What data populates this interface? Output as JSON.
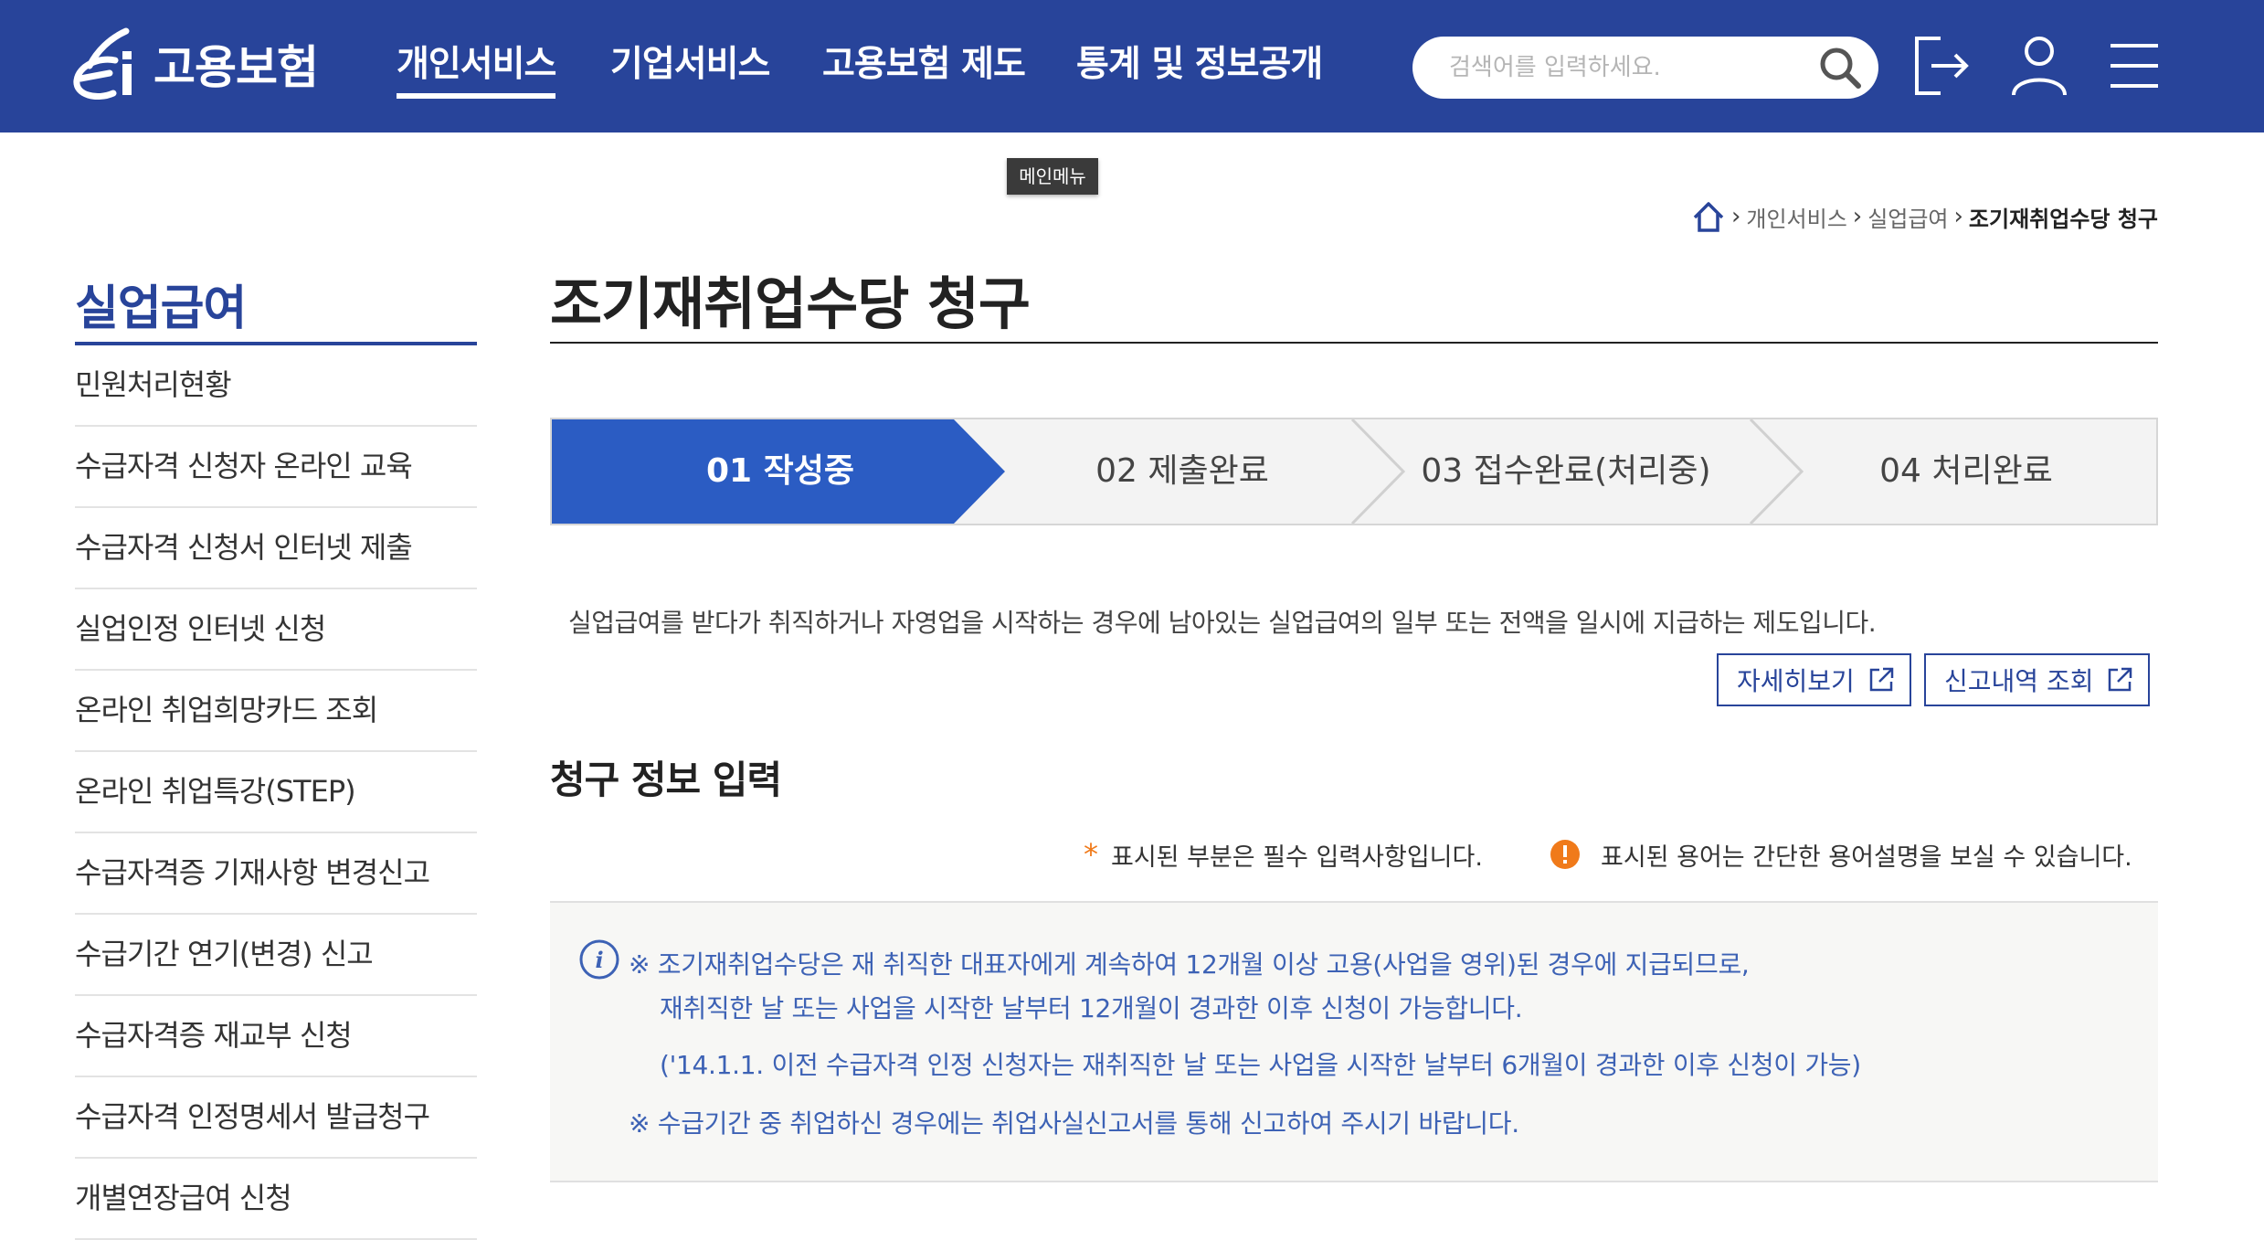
{
  "header": {
    "logo_text": "고용보험",
    "nav": [
      "개인서비스",
      "기업서비스",
      "고용보험 제도",
      "통계 및 정보공개"
    ],
    "active_nav": "개인서비스",
    "search_placeholder": "검색어를 입력하세요.",
    "icons": [
      "search-icon",
      "logout-icon",
      "user-icon",
      "menu-icon"
    ],
    "brand_color": "#28449a"
  },
  "tooltip": "메인메뉴",
  "breadcrumb": [
    "개인서비스",
    "실업급여",
    "조기재취업수당 청구"
  ],
  "sidebar": {
    "title": "실업급여",
    "items": [
      "민원처리현황",
      "수급자격 신청자 온라인 교육",
      "수급자격 신청서 인터넷 제출",
      "실업인정 인터넷 신청",
      "온라인 취업희망카드 조회",
      "온라인 취업특강(STEP)",
      "수급자격증 기재사항 변경신고",
      "수급기간 연기(변경) 신고",
      "수급자격증 재교부 신청",
      "수급자격 인정명세서 발급청구",
      "개별연장급여 신청"
    ]
  },
  "main": {
    "title": "조기재취업수당 청구",
    "steps": [
      "01 작성중",
      "02 제출완료",
      "03 접수완료(처리중)",
      "04 처리완료"
    ],
    "active_step": "01 작성중",
    "intro": "실업급여를 받다가 취직하거나 자영업을 시작하는 경우에 남아있는 실업급여의 일부 또는 전액을 일시에 지급하는 제도입니다.",
    "buttons": {
      "detail": "자세히보기",
      "history": "신고내역 조회"
    },
    "section_title": "청구 정보 입력",
    "required_note": "표시된 부분은 필수 입력사항입니다.",
    "term_note": "표시된 용어는 간단한 용어설명을 보실 수 있습니다.",
    "info": [
      "※ 조기재취업수당은 재 취직한 대표자에게 계속하여 12개월 이상 고용(사업을 영위)된 경우에 지급되므로,",
      "재취직한 날 또는 사업을 시작한 날부터 12개월이 경과한 이후 신청이 가능합니다.",
      "('14.1.1. 이전 수급자격 인정 신청자는 재취직한 날 또는 사업을 시작한 날부터 6개월이 경과한 이후 신청이 가능)",
      "※ 수급기간 중 취업하신 경우에는 취업사실신고서를 통해 신고하여 주시기 바랍니다."
    ]
  }
}
